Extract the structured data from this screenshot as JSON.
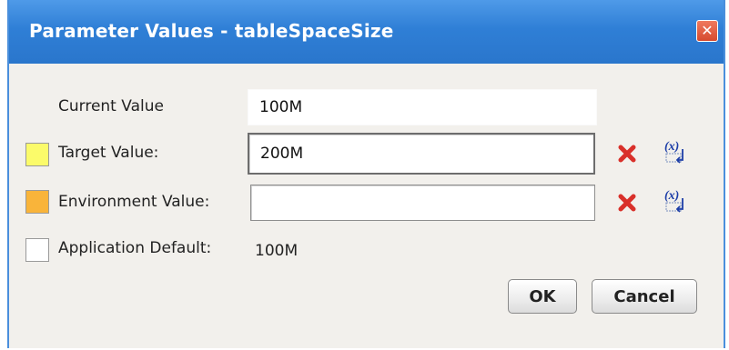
{
  "dialog": {
    "title": "Parameter Values - tableSpaceSize",
    "close_glyph": "✕"
  },
  "rows": {
    "current": {
      "label": "Current Value",
      "value": "100M"
    },
    "target": {
      "label": "Target Value:",
      "value": "200M",
      "swatch_color": "#fbfb6a"
    },
    "environment": {
      "label": "Environment Value:",
      "value": "",
      "swatch_color": "#f9b43a"
    },
    "app_default": {
      "label": "Application Default:",
      "value": "100M",
      "swatch_color": "#ffffff"
    }
  },
  "icons": {
    "clear": "clear-icon",
    "variable": "variable-icon",
    "variable_text": "(x)"
  },
  "buttons": {
    "ok": "OK",
    "cancel": "Cancel"
  },
  "colors": {
    "titlebar": "#2f7fd6",
    "dialog_bg": "#f2f0ec",
    "clear_red": "#d9302a"
  }
}
